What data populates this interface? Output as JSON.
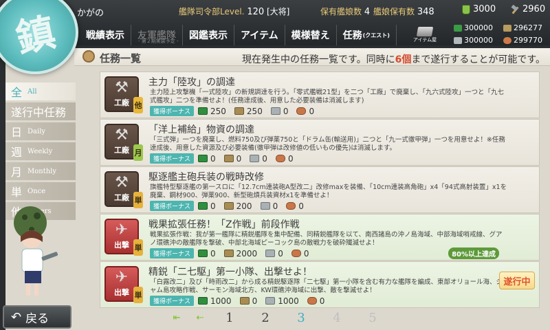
{
  "topbar": {
    "emblem_char": "鎮",
    "admiral_name": "かがの",
    "hq_label": "艦隊司令部Level.",
    "hq_level": "120",
    "rank": "[大将]",
    "ships_label": "保有艦娘数",
    "ships_value": "4",
    "equip_label": "艦娘保有数",
    "equip_value": "348",
    "bucket_value": "3000",
    "dev_mat_value": "2960"
  },
  "menu": {
    "items": [
      "戦績表示",
      "友軍艦隊",
      "図鑑表示",
      "アイテム",
      "模様替え",
      "任務"
    ],
    "friend_fleet_sub": "- 第２期実装予定 -",
    "quest_small": "(クエスト)",
    "item_shop_label": "アイテム屋"
  },
  "resources": {
    "fuel": "300000",
    "ammo": "296277",
    "steel": "300000",
    "bauxite": "299770"
  },
  "header": {
    "title": "任務一覧",
    "msg_before": "現在発生中の任務一覧です。同時に",
    "msg_number": "6個",
    "msg_after": "まで遂行することが可能です。"
  },
  "filters": [
    {
      "jp": "全",
      "en": "All"
    },
    {
      "jp": "遂行中任務",
      "en": ""
    },
    {
      "jp": "日",
      "en": "Daily"
    },
    {
      "jp": "週",
      "en": "Weekly"
    },
    {
      "jp": "月",
      "en": "Monthly"
    },
    {
      "jp": "単",
      "en": "Once"
    },
    {
      "jp": "他",
      "en": "Others"
    }
  ],
  "bonus_label": "獲得ボーナス",
  "quests": [
    {
      "category": "工廠",
      "type": "他",
      "title": "主力「陸攻」の調達",
      "desc": "主力陸上攻撃機「一式陸攻」の新規調達を行う。「零式艦戦21型」を二つ「工廠」で廃棄し、「九六式陸攻」一つと「九七式艦攻」二つを準備せよ！(任務達成後、用意した必要装備は消滅します)",
      "fuel": "250",
      "ammo": "250",
      "steel": "0",
      "bauxite": "0",
      "progress": "",
      "status": ""
    },
    {
      "category": "工廠",
      "type": "月",
      "title": "「洋上補給」物資の調達",
      "desc": "「三式弾」一つを廃棄し、燃料750及び弾薬750と「ドラム缶(輸送用)」二つと「九一式徹甲弾」一つを用意せよ！※任務達成後、用意した資源及び必要装備(徹甲弾は改修値の低いもの優先)は消滅します。",
      "fuel": "0",
      "ammo": "0",
      "steel": "0",
      "bauxite": "0",
      "progress": "",
      "status": ""
    },
    {
      "category": "工廠",
      "type": "単",
      "title": "駆逐艦主砲兵装の戦時改修",
      "desc": "旗艦特型駆逐艦の第一スロに「12.7cm連装砲A型改二」改修maxを装備、「10cm連装高角砲」x4「94式高射装置」x1を廃棄、鋼材900、弾薬900、新型砲熕兵装資材x1を準備せよ！",
      "fuel": "0",
      "ammo": "200",
      "steel": "0",
      "bauxite": "0",
      "progress": "",
      "status": ""
    },
    {
      "category": "出撃",
      "type": "単",
      "title": "戦果拡張任務！「Z作戦」前段作戦",
      "desc": "戦果拡張作戦：我が第一艦隊に精鋭艦隊を集中配備、同精鋭艦隊を以て、南西諸島の沖ノ島海域、中部海域哨戒線、グアノ環礁沖の敵艦隊を撃破、中部北海域ピーコック島の敵戦力を破砕殲滅せよ！",
      "fuel": "0",
      "ammo": "2000",
      "steel": "0",
      "bauxite": "0",
      "progress": "80%以上達成",
      "status": ""
    },
    {
      "category": "出撃",
      "type": "単",
      "title": "精鋭「二七駆」第一小隊、出撃せよ！",
      "desc": "「白露改二」及び「時雨改二」から成る精鋭駆逐隊「二七駆」第一小隊を含む有力な艦隊を編成、東部オリョール海、ジャム島攻略作戦、サーモン海域北方、KW環礁沖海域に出撃、敵を撃滅せよ！",
      "fuel": "1000",
      "ammo": "0",
      "steel": "1000",
      "bauxite": "0",
      "progress": "",
      "status": "遂行中"
    }
  ],
  "back_label": "戻る",
  "pager": {
    "first_arrow": "⇤",
    "prev_arrow": "⇠",
    "pages": [
      "1",
      "2",
      "3",
      "4",
      "5"
    ],
    "current": "3"
  }
}
